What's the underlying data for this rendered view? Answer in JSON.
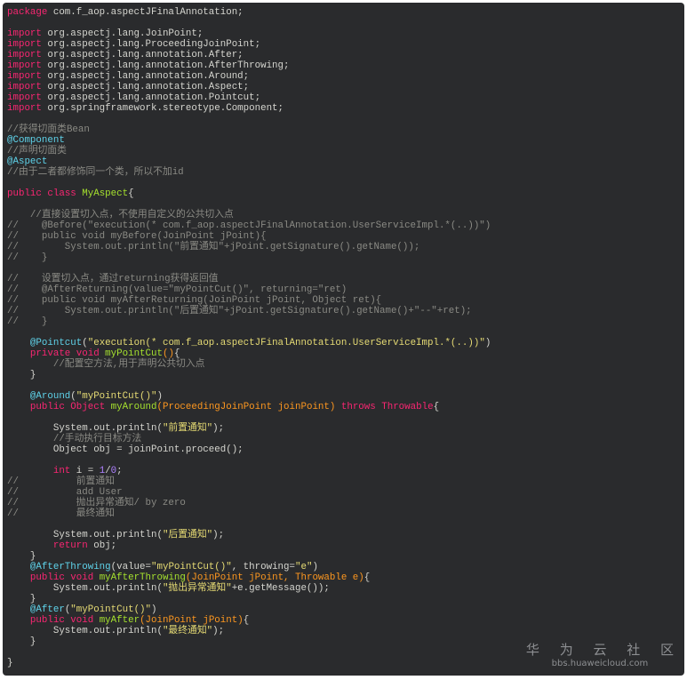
{
  "watermark": {
    "brand": "华 为 云 社 区",
    "url": "bbs.huaweicloud.com"
  },
  "lines": [
    [
      [
        "k",
        "package"
      ],
      [
        "p",
        " com.f_aop.aspectJFinalAnnotation;"
      ]
    ],
    [],
    [
      [
        "k",
        "import"
      ],
      [
        "p",
        " org.aspectj.lang.JoinPoint;"
      ]
    ],
    [
      [
        "k",
        "import"
      ],
      [
        "p",
        " org.aspectj.lang.ProceedingJoinPoint;"
      ]
    ],
    [
      [
        "k",
        "import"
      ],
      [
        "p",
        " org.aspectj.lang.annotation.After;"
      ]
    ],
    [
      [
        "k",
        "import"
      ],
      [
        "p",
        " org.aspectj.lang.annotation.AfterThrowing;"
      ]
    ],
    [
      [
        "k",
        "import"
      ],
      [
        "p",
        " org.aspectj.lang.annotation.Around;"
      ]
    ],
    [
      [
        "k",
        "import"
      ],
      [
        "p",
        " org.aspectj.lang.annotation.Aspect;"
      ]
    ],
    [
      [
        "k",
        "import"
      ],
      [
        "p",
        " org.aspectj.lang.annotation.Pointcut;"
      ]
    ],
    [
      [
        "k",
        "import"
      ],
      [
        "p",
        " org.springframework.stereotype.Component;"
      ]
    ],
    [],
    [
      [
        "c",
        "//获得切面类Bean"
      ]
    ],
    [
      [
        "a",
        "@Component"
      ]
    ],
    [
      [
        "c",
        "//声明切面类"
      ]
    ],
    [
      [
        "a",
        "@Aspect"
      ]
    ],
    [
      [
        "c",
        "//由于二者都修饰同一个类，所以不加id"
      ]
    ],
    [],
    [
      [
        "k",
        "public"
      ],
      [
        "p",
        " "
      ],
      [
        "k",
        "class"
      ],
      [
        "p",
        " "
      ],
      [
        "f",
        "MyAspect"
      ],
      [
        "p",
        "{"
      ]
    ],
    [],
    [
      [
        "c",
        "    //直接设置切入点，不使用自定义的公共切入点"
      ]
    ],
    [
      [
        "c",
        "//    @Before(\"execution(* com.f_aop.aspectJFinalAnnotation.UserServiceImpl.*(..))\")"
      ]
    ],
    [
      [
        "c",
        "//    public void myBefore(JoinPoint jPoint){"
      ]
    ],
    [
      [
        "c",
        "//        System.out.println(\"前置通知\"+jPoint.getSignature().getName());"
      ]
    ],
    [
      [
        "c",
        "//    }"
      ]
    ],
    [],
    [
      [
        "c",
        "//    设置切入点，通过returning获得返回值"
      ]
    ],
    [
      [
        "c",
        "//    @AfterReturning(value=\"myPointCut()\", returning=\"ret)"
      ]
    ],
    [
      [
        "c",
        "//    public void myAfterReturning(JoinPoint jPoint, Object ret){"
      ]
    ],
    [
      [
        "c",
        "//        System.out.println(\"后置通知\"+jPoint.getSignature().getName()+\"--\"+ret);"
      ]
    ],
    [
      [
        "c",
        "//    }"
      ]
    ],
    [],
    [
      [
        "p",
        "    "
      ],
      [
        "a",
        "@Pointcut"
      ],
      [
        "p",
        "("
      ],
      [
        "s",
        "\"execution(* com.f_aop.aspectJFinalAnnotation.UserServiceImpl.*(..))\""
      ],
      [
        "p",
        ")"
      ]
    ],
    [
      [
        "p",
        "    "
      ],
      [
        "k",
        "private"
      ],
      [
        "p",
        " "
      ],
      [
        "k",
        "void"
      ],
      [
        "p",
        " "
      ],
      [
        "f",
        "myPointCut"
      ],
      [
        "o",
        "()"
      ],
      [
        "p",
        "{"
      ]
    ],
    [
      [
        "c",
        "        //配置空方法,用于声明公共切入点"
      ]
    ],
    [
      [
        "p",
        "    }"
      ]
    ],
    [],
    [
      [
        "p",
        "    "
      ],
      [
        "a",
        "@Around"
      ],
      [
        "p",
        "("
      ],
      [
        "s",
        "\"myPointCut()\""
      ],
      [
        "p",
        ")"
      ]
    ],
    [
      [
        "p",
        "    "
      ],
      [
        "k",
        "public"
      ],
      [
        "p",
        " "
      ],
      [
        "k",
        "Object"
      ],
      [
        "p",
        " "
      ],
      [
        "f",
        "myAround"
      ],
      [
        "o",
        "(ProceedingJoinPoint joinPoint)"
      ],
      [
        "p",
        " "
      ],
      [
        "k",
        "throws"
      ],
      [
        "p",
        " "
      ],
      [
        "k",
        "Throwable"
      ],
      [
        "p",
        "{"
      ]
    ],
    [],
    [
      [
        "p",
        "        System.out.println("
      ],
      [
        "s",
        "\"前置通知\""
      ],
      [
        "p",
        ");"
      ]
    ],
    [
      [
        "c",
        "        //手动执行目标方法"
      ]
    ],
    [
      [
        "p",
        "        Object obj = joinPoint.proceed();"
      ]
    ],
    [],
    [
      [
        "p",
        "        "
      ],
      [
        "k",
        "int"
      ],
      [
        "p",
        " i = "
      ],
      [
        "n",
        "1"
      ],
      [
        "p",
        "/"
      ],
      [
        "n",
        "0"
      ],
      [
        "p",
        ";"
      ]
    ],
    [
      [
        "c",
        "//          前置通知"
      ]
    ],
    [
      [
        "c",
        "//          add User"
      ]
    ],
    [
      [
        "c",
        "//          抛出异常通知/ by zero"
      ]
    ],
    [
      [
        "c",
        "//          最终通知"
      ]
    ],
    [],
    [
      [
        "p",
        "        System.out.println("
      ],
      [
        "s",
        "\"后置通知\""
      ],
      [
        "p",
        ");"
      ]
    ],
    [
      [
        "p",
        "        "
      ],
      [
        "k",
        "return"
      ],
      [
        "p",
        " obj;"
      ]
    ],
    [
      [
        "p",
        "    }"
      ]
    ],
    [
      [
        "p",
        "    "
      ],
      [
        "a",
        "@AfterThrowing"
      ],
      [
        "p",
        "(value="
      ],
      [
        "s",
        "\"myPointCut()\""
      ],
      [
        "p",
        ", throwing="
      ],
      [
        "s",
        "\"e\""
      ],
      [
        "p",
        ")"
      ]
    ],
    [
      [
        "p",
        "    "
      ],
      [
        "k",
        "public"
      ],
      [
        "p",
        " "
      ],
      [
        "k",
        "void"
      ],
      [
        "p",
        " "
      ],
      [
        "f",
        "myAfterThrowing"
      ],
      [
        "o",
        "(JoinPoint jPoint, Throwable e)"
      ],
      [
        "p",
        "{"
      ]
    ],
    [
      [
        "p",
        "        System.out.println("
      ],
      [
        "s",
        "\"抛出异常通知\""
      ],
      [
        "p",
        "+e.getMessage());"
      ]
    ],
    [
      [
        "p",
        "    }"
      ]
    ],
    [
      [
        "p",
        "    "
      ],
      [
        "a",
        "@After"
      ],
      [
        "p",
        "("
      ],
      [
        "s",
        "\"myPointCut()\""
      ],
      [
        "p",
        ")"
      ]
    ],
    [
      [
        "p",
        "    "
      ],
      [
        "k",
        "public"
      ],
      [
        "p",
        " "
      ],
      [
        "k",
        "void"
      ],
      [
        "p",
        " "
      ],
      [
        "f",
        "myAfter"
      ],
      [
        "o",
        "(JoinPoint jPoint)"
      ],
      [
        "p",
        "{"
      ]
    ],
    [
      [
        "p",
        "        System.out.println("
      ],
      [
        "s",
        "\"最终通知\""
      ],
      [
        "p",
        ");"
      ]
    ],
    [
      [
        "p",
        "    }"
      ]
    ],
    [],
    [
      [
        "p",
        "}"
      ]
    ]
  ]
}
